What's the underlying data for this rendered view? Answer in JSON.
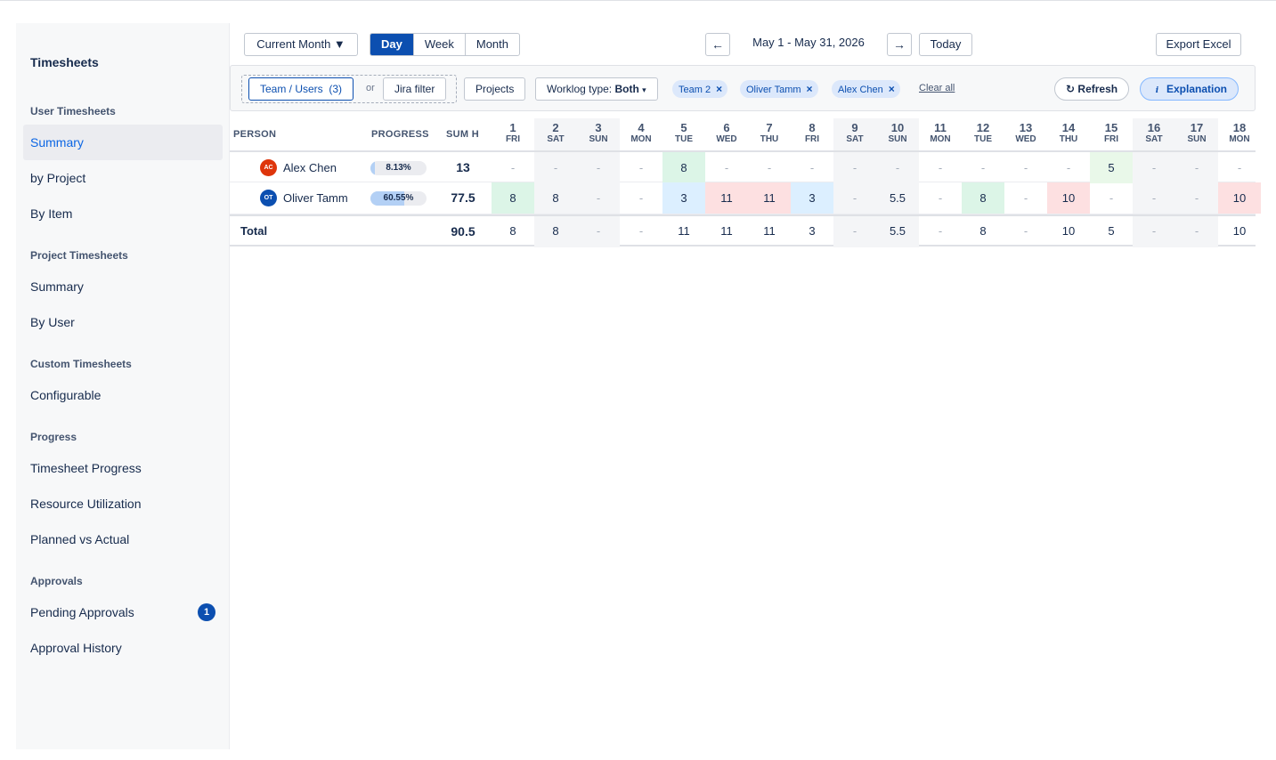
{
  "sidebar": {
    "title": "Timesheets",
    "sections": [
      {
        "label": "User Timesheets",
        "items": [
          {
            "label": "Summary",
            "active": true
          },
          {
            "label": "by Project"
          },
          {
            "label": "By Item"
          }
        ]
      },
      {
        "label": "Project Timesheets",
        "items": [
          {
            "label": "Summary"
          },
          {
            "label": "By User"
          }
        ]
      },
      {
        "label": "Custom Timesheets",
        "items": [
          {
            "label": "Configurable"
          }
        ]
      },
      {
        "label": "Progress",
        "items": [
          {
            "label": "Timesheet Progress"
          },
          {
            "label": "Resource Utilization"
          },
          {
            "label": "Planned vs Actual"
          }
        ]
      },
      {
        "label": "Approvals",
        "items": [
          {
            "label": "Pending Approvals",
            "badge": "1"
          },
          {
            "label": "Approval History"
          }
        ]
      }
    ]
  },
  "toolbar": {
    "period_dropdown": "Current Month ▼",
    "view_modes": [
      "Day",
      "Week",
      "Month"
    ],
    "active_view": "Day",
    "prev_icon": "←",
    "next_icon": "→",
    "date_range": "May 1 - May 31, 2026",
    "today_label": "Today",
    "export_label": "Export Excel"
  },
  "filters": {
    "team_users_label": "Team / Users",
    "team_users_count": "(3)",
    "or_label": "or",
    "jira_filter_label": "Jira filter",
    "projects_label": "Projects",
    "worklog_label": "Worklog type:",
    "worklog_value": "Both",
    "worklog_caret": "▾",
    "chips": [
      "Team 2",
      "Oliver Tamm",
      "Alex Chen"
    ],
    "clear_all": "Clear all",
    "refresh_label": "Refresh",
    "refresh_icon": "↻",
    "explanation_label": "Explanation",
    "explanation_icon": "i"
  },
  "table": {
    "headers": {
      "person": "PERSON",
      "progress": "PROGRESS",
      "sum": "SUM H"
    },
    "days": [
      {
        "num": "1",
        "dow": "FRI",
        "weekend": false
      },
      {
        "num": "2",
        "dow": "SAT",
        "weekend": true
      },
      {
        "num": "3",
        "dow": "SUN",
        "weekend": true
      },
      {
        "num": "4",
        "dow": "MON",
        "weekend": false
      },
      {
        "num": "5",
        "dow": "TUE",
        "weekend": false
      },
      {
        "num": "6",
        "dow": "WED",
        "weekend": false
      },
      {
        "num": "7",
        "dow": "THU",
        "weekend": false
      },
      {
        "num": "8",
        "dow": "FRI",
        "weekend": false
      },
      {
        "num": "9",
        "dow": "SAT",
        "weekend": true
      },
      {
        "num": "10",
        "dow": "SUN",
        "weekend": true
      },
      {
        "num": "11",
        "dow": "MON",
        "weekend": false
      },
      {
        "num": "12",
        "dow": "TUE",
        "weekend": false
      },
      {
        "num": "13",
        "dow": "WED",
        "weekend": false
      },
      {
        "num": "14",
        "dow": "THU",
        "weekend": false
      },
      {
        "num": "15",
        "dow": "FRI",
        "weekend": false
      },
      {
        "num": "16",
        "dow": "SAT",
        "weekend": true
      },
      {
        "num": "17",
        "dow": "SUN",
        "weekend": true
      },
      {
        "num": "18",
        "dow": "MON",
        "weekend": false
      }
    ],
    "rows": [
      {
        "initials": "AC",
        "avatar_color": "#de350b",
        "name": "Alex Chen",
        "progress_text": "8.13%",
        "progress": 0.0813,
        "sum": "13",
        "cells": [
          {
            "v": "-"
          },
          {
            "v": "-"
          },
          {
            "v": "-"
          },
          {
            "v": "-"
          },
          {
            "v": "8",
            "tone": "green"
          },
          {
            "v": "-"
          },
          {
            "v": "-"
          },
          {
            "v": "-"
          },
          {
            "v": "-"
          },
          {
            "v": "-"
          },
          {
            "v": "-"
          },
          {
            "v": "-"
          },
          {
            "v": "-"
          },
          {
            "v": "-"
          },
          {
            "v": "5",
            "tone": "lightgreen"
          },
          {
            "v": "-"
          },
          {
            "v": "-"
          },
          {
            "v": "-"
          }
        ]
      },
      {
        "initials": "OT",
        "avatar_color": "#0c4fb0",
        "name": "Oliver Tamm",
        "progress_text": "60.55%",
        "progress": 0.6055,
        "sum": "77.5",
        "cells": [
          {
            "v": "8",
            "tone": "green"
          },
          {
            "v": "8"
          },
          {
            "v": "-"
          },
          {
            "v": "-"
          },
          {
            "v": "3",
            "tone": "blue"
          },
          {
            "v": "11",
            "tone": "red"
          },
          {
            "v": "11",
            "tone": "red"
          },
          {
            "v": "3",
            "tone": "blue"
          },
          {
            "v": "-"
          },
          {
            "v": "5.5"
          },
          {
            "v": "-"
          },
          {
            "v": "8",
            "tone": "green"
          },
          {
            "v": "-"
          },
          {
            "v": "10",
            "tone": "red"
          },
          {
            "v": "-"
          },
          {
            "v": "-"
          },
          {
            "v": "-"
          },
          {
            "v": "10",
            "tone": "red"
          }
        ]
      }
    ],
    "total": {
      "label": "Total",
      "sum": "90.5",
      "cells": [
        "8",
        "8",
        "-",
        "-",
        "11",
        "11",
        "11",
        "3",
        "-",
        "5.5",
        "-",
        "8",
        "-",
        "10",
        "5",
        "-",
        "-",
        "10"
      ]
    },
    "tone_colors": {
      "green": "#dcf5e7",
      "lightgreen": "#e9f8e9",
      "blue": "#dcefff",
      "red": "#fde0e1"
    }
  }
}
